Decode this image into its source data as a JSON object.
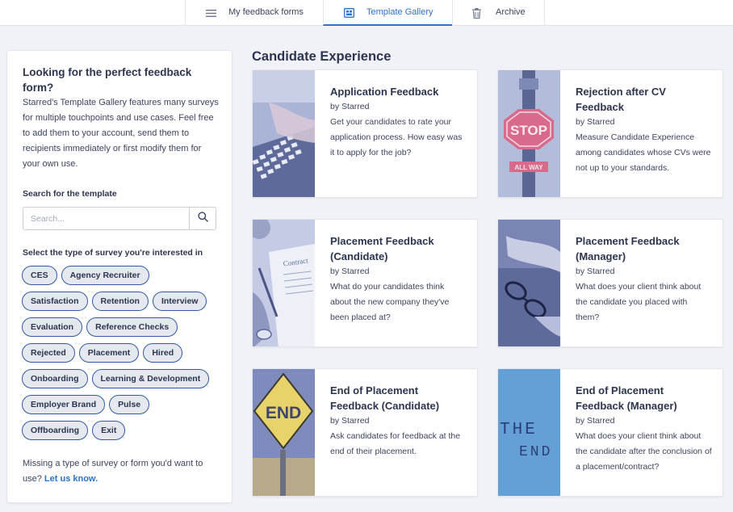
{
  "nav": {
    "tabs": [
      {
        "label": "My feedback forms",
        "icon": "list-icon",
        "active": false
      },
      {
        "label": "Template Gallery",
        "icon": "gallery-icon",
        "active": true
      },
      {
        "label": "Archive",
        "icon": "trash-icon",
        "active": false
      }
    ]
  },
  "sidebar": {
    "title": "Looking for the perfect feedback form?",
    "description": "Starred's Template Gallery features many surveys for multiple touchpoints and use cases. Feel free to add them to your account, send them to recipients immediately or first modify them for your own use.",
    "search_label": "Search for the template",
    "search_placeholder": "Search...",
    "search_value": "",
    "type_label": "Select the type of survey you're interested in",
    "tags": [
      "CES",
      "Agency Recruiter",
      "Satisfaction",
      "Retention",
      "Interview",
      "Evaluation",
      "Reference Checks",
      "Rejected",
      "Placement",
      "Hired",
      "Onboarding",
      "Learning & Development",
      "Employer Brand",
      "Pulse",
      "Offboarding",
      "Exit"
    ],
    "missing_text": "Missing a type of survey or form you'd want to use?",
    "missing_link": "Let us know."
  },
  "main": {
    "section_title": "Candidate Experience",
    "cards": [
      {
        "title": "Application Feedback",
        "by": "by Starred",
        "description": "Get your candidates to rate your application process. How easy was it to apply for the job?",
        "image": "keyboard"
      },
      {
        "title": "Rejection after CV Feedback",
        "by": "by Starred",
        "description": "Measure Candidate Experience among candidates whose CVs were not up to your standards.",
        "image": "stop-sign",
        "image_text": [
          "STOP",
          "ALL WAY"
        ]
      },
      {
        "title": "Placement Feedback (Candidate)",
        "by": "by Starred",
        "description": "What do your candidates think about the new company they've been placed at?",
        "image": "contract",
        "image_text": [
          "Contract"
        ]
      },
      {
        "title": "Placement Feedback (Manager)",
        "by": "by Starred",
        "description": "What does your client think about the candidate you placed with them?",
        "image": "glasses-hand"
      },
      {
        "title": "End of Placement Feedback (Candidate)",
        "by": "by Starred",
        "description": "Ask candidates for feedback at the end of their placement.",
        "image": "end-sign",
        "image_text": [
          "END"
        ]
      },
      {
        "title": "End of Placement Feedback (Manager)",
        "by": "by Starred",
        "description": "What does your client think about the candidate after the conclusion of a placement/contract?",
        "image": "the-end",
        "image_text": [
          "THE",
          "END"
        ]
      }
    ]
  },
  "colors": {
    "accent": "#2c73c9",
    "tag_border": "#2f5aa3",
    "text": "#2c3550",
    "background": "#f1f2f7"
  }
}
